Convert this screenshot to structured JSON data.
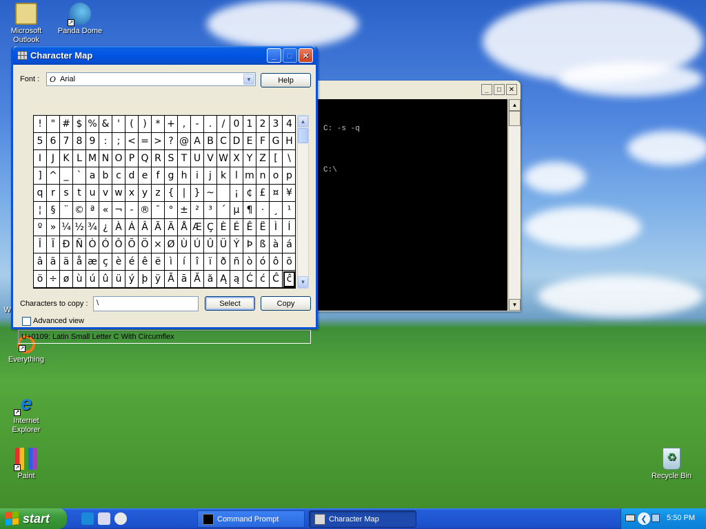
{
  "desktop": {
    "icons": [
      {
        "label": "Microsoft Outlook"
      },
      {
        "label": "Panda Dome"
      },
      {
        "label": "Everything"
      },
      {
        "label": "Internet Explorer"
      },
      {
        "label": "Paint"
      },
      {
        "label": "Recycle Bin"
      }
    ],
    "partial_label": "Wi"
  },
  "console": {
    "title": "Command Prompt",
    "lines": [
      "C: -s -q",
      "C:\\"
    ]
  },
  "charmap": {
    "title": "Character Map",
    "font_label": "Font :",
    "font_value": "Arial",
    "help_label": "Help",
    "chars": [
      "!",
      "\"",
      "#",
      "$",
      "%",
      "&",
      "'",
      "(",
      ")",
      "*",
      "+",
      ",",
      "-",
      ".",
      "/",
      "0",
      "1",
      "2",
      "3",
      "4",
      "5",
      "6",
      "7",
      "8",
      "9",
      ":",
      ";",
      "<",
      "=",
      ">",
      "?",
      "@",
      "A",
      "B",
      "C",
      "D",
      "E",
      "F",
      "G",
      "H",
      "I",
      "J",
      "K",
      "L",
      "M",
      "N",
      "O",
      "P",
      "Q",
      "R",
      "S",
      "T",
      "U",
      "V",
      "W",
      "X",
      "Y",
      "Z",
      "[",
      "\\",
      "]",
      "^",
      "_",
      "`",
      "a",
      "b",
      "c",
      "d",
      "e",
      "f",
      "g",
      "h",
      "i",
      "j",
      "k",
      "l",
      "m",
      "n",
      "o",
      "p",
      "q",
      "r",
      "s",
      "t",
      "u",
      "v",
      "w",
      "x",
      "y",
      "z",
      "{",
      "|",
      "}",
      "~",
      "",
      "¡",
      "¢",
      "£",
      "¤",
      "¥",
      "¦",
      "§",
      "¨",
      "©",
      "ª",
      "«",
      "¬",
      "-",
      "®",
      "¯",
      "°",
      "±",
      "²",
      "³",
      "´",
      "µ",
      "¶",
      "·",
      "¸",
      "¹",
      "º",
      "»",
      "¼",
      "½",
      "¾",
      "¿",
      "À",
      "Á",
      "Â",
      "Ã",
      "Ä",
      "Å",
      "Æ",
      "Ç",
      "È",
      "É",
      "Ê",
      "Ë",
      "Ì",
      "Í",
      "Î",
      "Ï",
      "Ð",
      "Ñ",
      "Ò",
      "Ó",
      "Ô",
      "Õ",
      "Ö",
      "×",
      "Ø",
      "Ù",
      "Ú",
      "Û",
      "Ü",
      "Ý",
      "Þ",
      "ß",
      "à",
      "á",
      "â",
      "ã",
      "ä",
      "å",
      "æ",
      "ç",
      "è",
      "é",
      "ê",
      "ë",
      "ì",
      "í",
      "î",
      "ï",
      "ð",
      "ñ",
      "ò",
      "ó",
      "ô",
      "õ",
      "ö",
      "÷",
      "ø",
      "ù",
      "ú",
      "û",
      "ü",
      "ý",
      "þ",
      "ÿ",
      "Ā",
      "ā",
      "Ă",
      "ă",
      "Ą",
      "ą",
      "Ć",
      "ć",
      "Ĉ",
      "ĉ"
    ],
    "selected_index": 199,
    "copy_label": "Characters to copy :",
    "copy_value": "\\",
    "select_label": "Select",
    "copy_button_label": "Copy",
    "advanced_label": "Advanced view",
    "advanced_checked": false,
    "status": "U+0109: Latin Small Letter C With Circumflex"
  },
  "taskbar": {
    "start_label": "start",
    "tasks": [
      {
        "label": "Command Prompt",
        "active": false
      },
      {
        "label": "Character Map",
        "active": true
      }
    ],
    "clock": "5:50 PM"
  }
}
